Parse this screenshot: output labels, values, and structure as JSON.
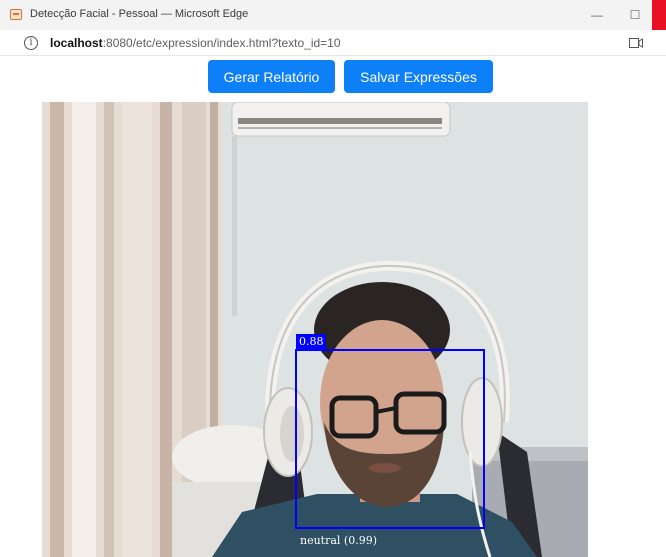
{
  "window": {
    "title": "Detecção Facial - Pessoal — Microsoft Edge",
    "minimize": "—",
    "maximize": "☐"
  },
  "address": {
    "host": "localhost",
    "path": ":8080/etc/expression/index.html?texto_id=10",
    "info": "i"
  },
  "toolbar": {
    "report_label": "Gerar Relatório",
    "save_label": "Salvar Expressões"
  },
  "detection": {
    "score": "0.88",
    "expression": "neutral (0.99)",
    "box_color": "#0000ff"
  },
  "icons": [
    "app-icon",
    "info-icon",
    "camera-icon"
  ]
}
